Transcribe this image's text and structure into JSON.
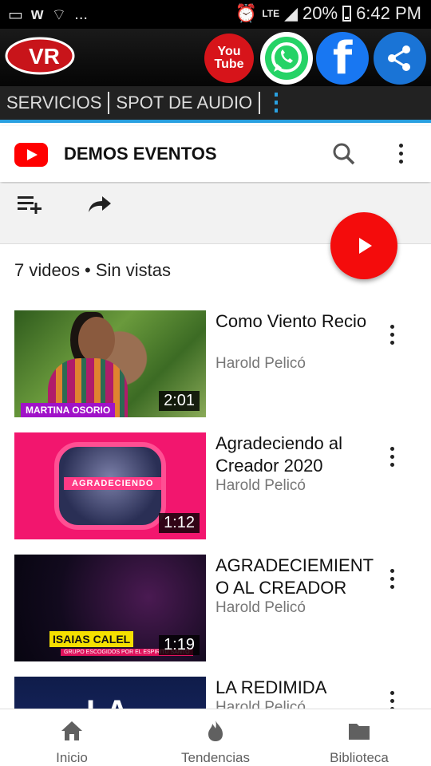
{
  "status_bar": {
    "left_icons": [
      "image-icon",
      "w-icon",
      "wifi-icon"
    ],
    "ellipsis": "...",
    "network": "LTE",
    "battery": "20%",
    "time": "6:42 PM"
  },
  "app_header": {
    "logo_text": "VR",
    "youtube_label": "You Tube"
  },
  "menu": {
    "items": [
      "SERVICIOS",
      "SPOT DE AUDIO"
    ]
  },
  "yt_header": {
    "title": "DEMOS EVENTOS"
  },
  "playlist": {
    "meta": "7 videos • Sin vistas"
  },
  "videos": [
    {
      "title": "Como Viento Recio",
      "channel": "Harold Pelicó",
      "duration": "2:01",
      "thumb_text": "MARTINA OSORIO"
    },
    {
      "title": "Agradeciendo al Creador 2020",
      "channel": "Harold Pelicó",
      "duration": "1:12",
      "thumb_text": "AGRADECIENDO"
    },
    {
      "title": "AGRADECIEMIENTO AL CREADOR",
      "channel": "Harold Pelicó",
      "duration": "1:19",
      "thumb_text": "ISAIAS CALEL",
      "thumb_sub": "GRUPO ESCOGIDOS POR EL ESPIRITU SANTO"
    },
    {
      "title": "LA REDIMIDA",
      "channel": "Harold Pelicó",
      "thumb_text": "LA"
    }
  ],
  "bottom_nav": {
    "items": [
      "Inicio",
      "Tendencias",
      "Biblioteca"
    ]
  },
  "colors": {
    "accent": "#2aa0e0",
    "youtube_red": "#ff0000"
  }
}
